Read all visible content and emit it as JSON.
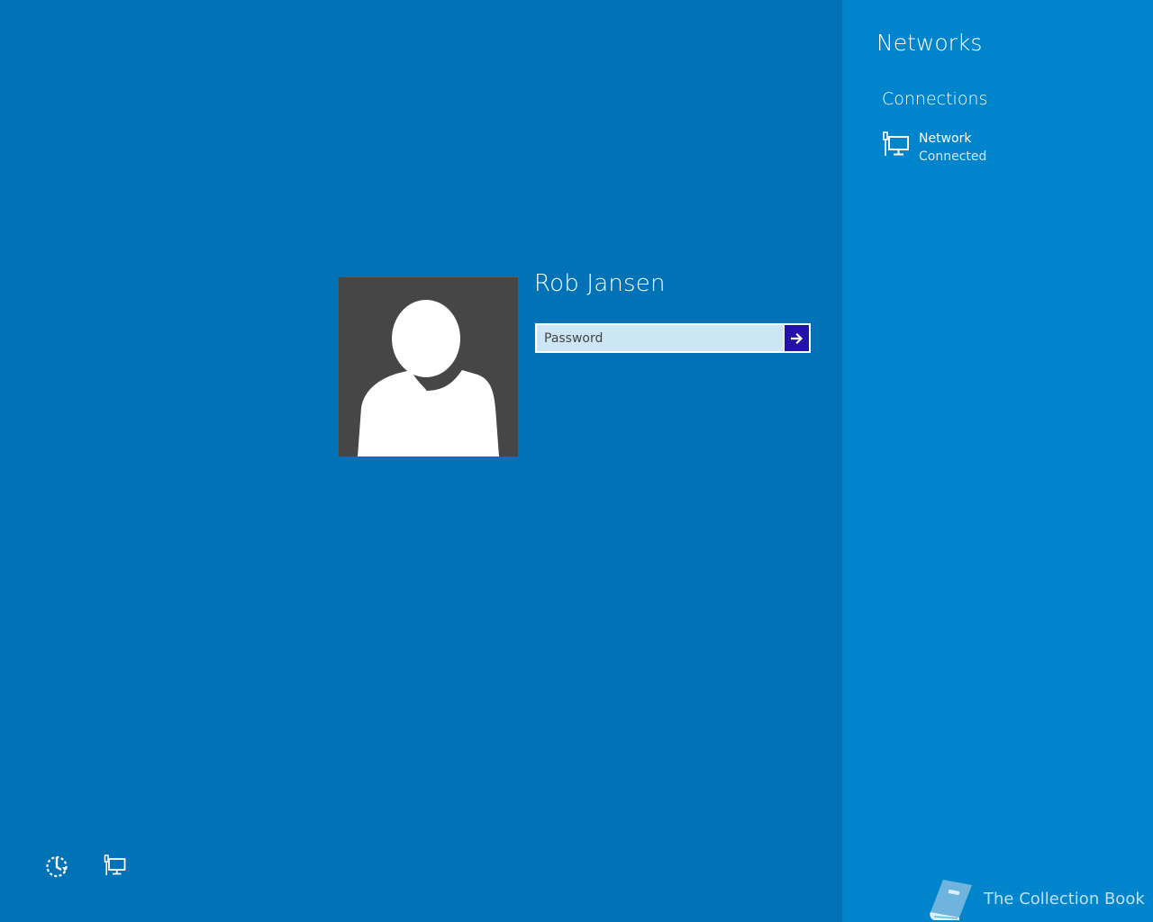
{
  "login": {
    "username": "Rob Jansen",
    "password_placeholder": "Password",
    "avatar_icon": "user-silhouette-icon",
    "submit_icon": "arrow-right-icon"
  },
  "bottom_bar": {
    "ease_of_access_icon": "ease-of-access-icon",
    "network_icon": "wired-network-icon"
  },
  "networks_panel": {
    "title": "Networks",
    "section_title": "Connections",
    "connections": [
      {
        "name": "Network",
        "status": "Connected",
        "icon": "wired-network-icon"
      }
    ]
  },
  "watermark": {
    "text": "The Collection Book",
    "icon": "book-icon"
  },
  "colors": {
    "background": "#0072b5",
    "panel": "#0085cd",
    "avatar_bg": "#464646",
    "input_bg": "#cde6f5",
    "submit_button": "#2411a8"
  }
}
